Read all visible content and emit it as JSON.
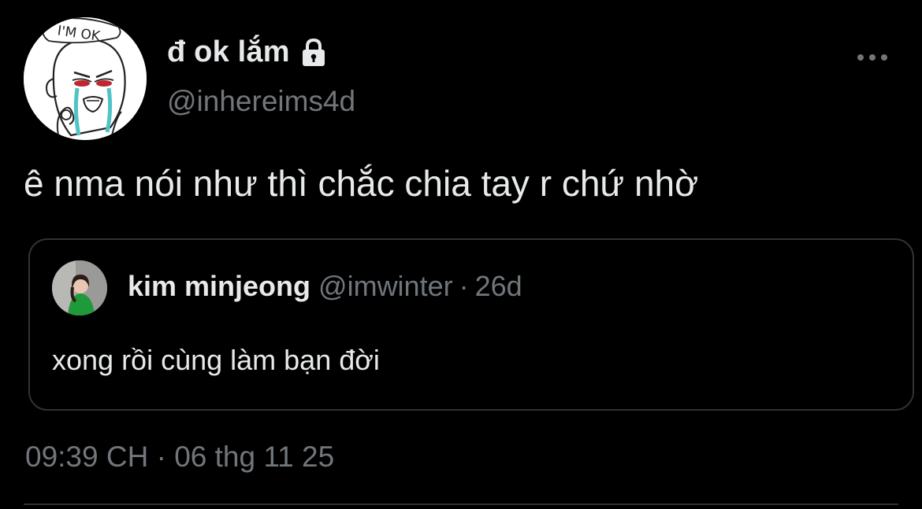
{
  "author": {
    "display_name": "đ ok lắm",
    "handle": "@inhereims4d",
    "avatar_caption": "I'M OK",
    "protected_icon": "lock-icon"
  },
  "more_icon": "more-horizontal-icon",
  "tweet": {
    "text": "ê nma nói như thì chắc chia tay r chứ nhờ"
  },
  "quoted_tweet": {
    "display_name": "kim minjeong",
    "handle": "@imwinter",
    "separator": "·",
    "relative_time": "26d",
    "text": "xong rồi cùng làm bạn đời"
  },
  "meta": {
    "time": "09:39 CH",
    "separator": "·",
    "date": "06 thg 11 25"
  },
  "colors": {
    "background": "#000000",
    "primary_text": "#e7e9ea",
    "secondary_text": "#71767b",
    "border": "#2f3336"
  }
}
